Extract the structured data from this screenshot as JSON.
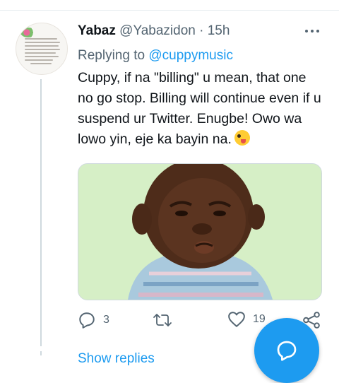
{
  "tweet": {
    "display_name": "Yabaz",
    "handle": "@Yabazidon",
    "separator": "·",
    "time": "15h",
    "replying_prefix": "Replying to",
    "replying_to": "@cuppymusic",
    "text": "Cuppy, if na \"billing\" u mean, that one no go stop. Billing will continue even if u suspend ur Twitter. Enugbe! Owo wa lowo yin, eje ka bayin na.",
    "emoji": "zany-face-emoji",
    "media_alt": "child meme image"
  },
  "actions": {
    "reply_count": "3",
    "retweet_count": "",
    "like_count": "19"
  },
  "thread": {
    "show_replies": "Show replies"
  },
  "colors": {
    "accent": "#1d9bf0",
    "muted": "#536471",
    "text": "#0f1419",
    "divider": "#cfd9de"
  }
}
